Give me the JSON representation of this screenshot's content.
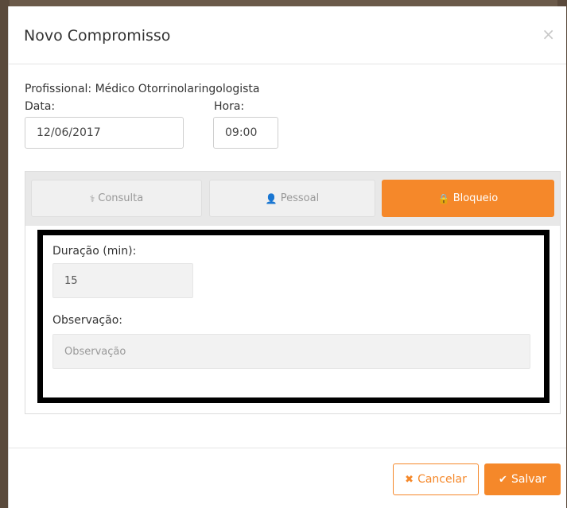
{
  "modal": {
    "title": "Novo Compromisso",
    "close_icon": "×"
  },
  "form": {
    "profissional_label": "Profissional: Médico Otorrinolaringologista",
    "data_label": "Data:",
    "data_value": "12/06/2017",
    "hora_label": "Hora:",
    "hora_value": "09:00"
  },
  "tabs": [
    {
      "label": "Consulta",
      "icon": "user-md-icon",
      "glyph": "⚕",
      "active": false
    },
    {
      "label": "Pessoal",
      "icon": "user-icon",
      "glyph": "👤",
      "active": false
    },
    {
      "label": "Bloqueio",
      "icon": "lock-icon",
      "glyph": "🔒",
      "active": true
    }
  ],
  "bloqueio": {
    "duracao_label": "Duração (min):",
    "duracao_value": "15",
    "observacao_label": "Observação:",
    "observacao_placeholder": "Observação"
  },
  "footer": {
    "cancel_label": "Cancelar",
    "cancel_icon": "✖",
    "save_label": "Salvar",
    "save_icon": "✔"
  },
  "colors": {
    "accent": "#f5882a"
  }
}
